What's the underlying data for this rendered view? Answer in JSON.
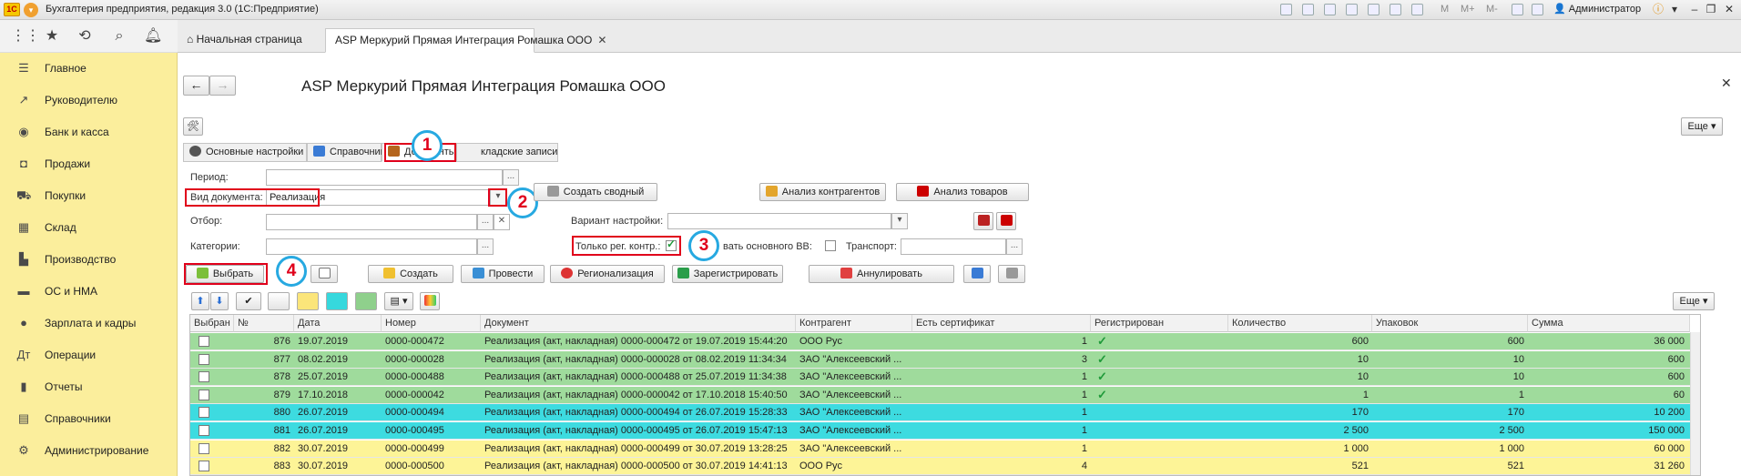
{
  "app": {
    "logo_text": "1С",
    "title": "Бухгалтерия предприятия, редакция 3.0  (1С:Предприятие)",
    "toolbar_text": [
      "M",
      "M+",
      "M-"
    ],
    "user": "Администратор"
  },
  "tabs": {
    "home": "Начальная страница",
    "active": "ASP Меркурий Прямая Интеграция Ромашка ООО"
  },
  "sidebar": [
    {
      "label": "Главное",
      "icon": "menu-icon"
    },
    {
      "label": "Руководителю",
      "icon": "chart-line-icon"
    },
    {
      "label": "Банк и касса",
      "icon": "coin-icon"
    },
    {
      "label": "Продажи",
      "icon": "bag-icon"
    },
    {
      "label": "Покупки",
      "icon": "cart-icon"
    },
    {
      "label": "Склад",
      "icon": "grid-icon"
    },
    {
      "label": "Производство",
      "icon": "factory-icon"
    },
    {
      "label": "ОС и НМА",
      "icon": "truck-icon"
    },
    {
      "label": "Зарплата и кадры",
      "icon": "person-icon"
    },
    {
      "label": "Операции",
      "icon": "operations-icon"
    },
    {
      "label": "Отчеты",
      "icon": "bar-chart-icon"
    },
    {
      "label": "Справочники",
      "icon": "book-icon"
    },
    {
      "label": "Администрирование",
      "icon": "gear-icon"
    }
  ],
  "form": {
    "title": "ASP Меркурий Прямая Интеграция Ромашка ООО",
    "more": "Еще",
    "section_tabs": [
      "Основные настройки",
      "Справочники",
      "Документы",
      "Складские записи"
    ],
    "section_tab_partial": "кладские записи",
    "period_label": "Период:",
    "period_value": "",
    "doc_type_label": "Вид документа:",
    "doc_type_value": "Реализация",
    "filter_label": "Отбор:",
    "categories_label": "Категории:",
    "create_summary": "Создать сводный",
    "analyze_contractors": "Анализ контрагентов",
    "analyze_goods": "Анализ товаров",
    "variant_label": "Вариант настройки:",
    "only_reg_label": "Только рег. контр.:",
    "basic_vv_label": "вать основного ВВ:",
    "transport_label": "Транспорт:",
    "actions": {
      "select": "Выбрать",
      "create": "Создать",
      "post": "Провести",
      "regionalize": "Регионализация",
      "register": "Зарегистрировать",
      "cancel": "Аннулировать"
    },
    "callouts": [
      "1",
      "2",
      "3",
      "4"
    ]
  },
  "table": {
    "columns": [
      "Выбран",
      "№",
      "Дата",
      "Номер",
      "Документ",
      "Контрагент",
      "Есть сертификат",
      "Регистрирован",
      "Количество",
      "Упаковок",
      "Сумма"
    ],
    "rows": [
      {
        "num": "876",
        "date": "19.07.2019",
        "number": "0000-000472",
        "doc": "Реализация (акт, накладная) 0000-000472 от 19.07.2019 15:44:20",
        "contractor": "ООО Рус",
        "cert": "1",
        "reg": true,
        "qty": "600",
        "packs": "600",
        "sum": "36 000",
        "color": "#9fdb9c"
      },
      {
        "num": "877",
        "date": "08.02.2019",
        "number": "0000-000028",
        "doc": "Реализация (акт, накладная) 0000-000028 от 08.02.2019 11:34:34",
        "contractor": "ЗАО \"Алексеевский ...",
        "cert": "3",
        "reg": true,
        "qty": "10",
        "packs": "10",
        "sum": "600",
        "color": "#9fdb9c"
      },
      {
        "num": "878",
        "date": "25.07.2019",
        "number": "0000-000488",
        "doc": "Реализация (акт, накладная) 0000-000488 от 25.07.2019 11:34:38",
        "contractor": "ЗАО \"Алексеевский ...",
        "cert": "1",
        "reg": true,
        "qty": "10",
        "packs": "10",
        "sum": "600",
        "color": "#9fdb9c"
      },
      {
        "num": "879",
        "date": "17.10.2018",
        "number": "0000-000042",
        "doc": "Реализация (акт, накладная) 0000-000042 от 17.10.2018 15:40:50",
        "contractor": "ЗАО \"Алексеевский ...",
        "cert": "1",
        "reg": true,
        "qty": "1",
        "packs": "1",
        "sum": "60",
        "color": "#9fdb9c"
      },
      {
        "num": "880",
        "date": "26.07.2019",
        "number": "0000-000494",
        "doc": "Реализация (акт, накладная) 0000-000494 от 26.07.2019 15:28:33",
        "contractor": "ЗАО \"Алексеевский ...",
        "cert": "1",
        "reg": false,
        "qty": "170",
        "packs": "170",
        "sum": "10 200",
        "color": "#3ddbe0"
      },
      {
        "num": "881",
        "date": "26.07.2019",
        "number": "0000-000495",
        "doc": "Реализация (акт, накладная) 0000-000495 от 26.07.2019 15:47:13",
        "contractor": "ЗАО \"Алексеевский ...",
        "cert": "1",
        "reg": false,
        "qty": "2 500",
        "packs": "2 500",
        "sum": "150 000",
        "color": "#3ddbe0"
      },
      {
        "num": "882",
        "date": "30.07.2019",
        "number": "0000-000499",
        "doc": "Реализация (акт, накладная) 0000-000499 от 30.07.2019 13:28:25",
        "contractor": "ЗАО \"Алексеевский ...",
        "cert": "1",
        "reg": false,
        "qty": "1 000",
        "packs": "1 000",
        "sum": "60 000",
        "color": "#fdf497"
      },
      {
        "num": "883",
        "date": "30.07.2019",
        "number": "0000-000500",
        "doc": "Реализация (акт, накладная) 0000-000500 от 30.07.2019 14:41:13",
        "contractor": "ООО Рус",
        "cert": "4",
        "reg": false,
        "qty": "521",
        "packs": "521",
        "sum": "31 260",
        "color": "#fdf497"
      }
    ]
  },
  "colors": {
    "sidebar_bg": "#fbee9c",
    "row_green": "#9fdb9c",
    "row_cyan": "#3ddbe0",
    "row_yellow": "#fdf497",
    "highlight_red": "#e0001b",
    "callout_blue": "#27a9e1"
  }
}
